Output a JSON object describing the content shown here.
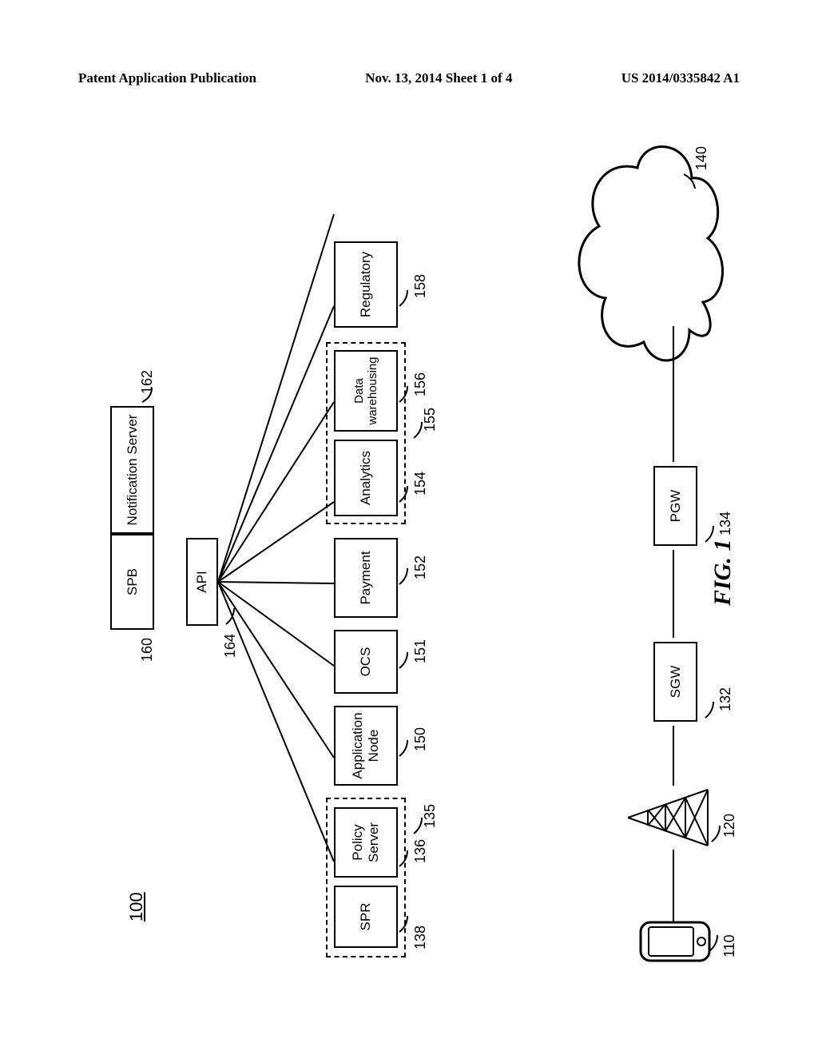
{
  "header": {
    "left": "Patent Application Publication",
    "center": "Nov. 13, 2014  Sheet 1 of 4",
    "right": "US 2014/0335842 A1"
  },
  "system_ref": "100",
  "figure_caption": "FIG.  1",
  "nodes": {
    "spb": {
      "label": "SPB",
      "ref": "160"
    },
    "notif": {
      "label": "Notification Server",
      "ref": "162"
    },
    "api": {
      "label": "API",
      "ref": "164"
    },
    "spr": {
      "label": "SPR",
      "ref": "138"
    },
    "policy": {
      "label": "Policy Server",
      "ref": "136"
    },
    "policy_grp": {
      "ref": "135"
    },
    "appnode": {
      "label": "Application Node",
      "ref": "150"
    },
    "ocs": {
      "label": "OCS",
      "ref": "151"
    },
    "payment": {
      "label": "Payment",
      "ref": "152"
    },
    "analytics": {
      "label": "Analytics",
      "ref": "154"
    },
    "dwh": {
      "label": "Data warehousing",
      "ref": "156"
    },
    "analytics_grp": {
      "ref": "155"
    },
    "regulatory": {
      "label": "Regulatory",
      "ref": "158"
    },
    "sgw": {
      "label": "SGW",
      "ref": "132"
    },
    "pgw": {
      "label": "PGW",
      "ref": "134"
    },
    "ue": {
      "ref": "110"
    },
    "tower": {
      "ref": "120"
    },
    "cloud": {
      "ref": "140"
    }
  }
}
